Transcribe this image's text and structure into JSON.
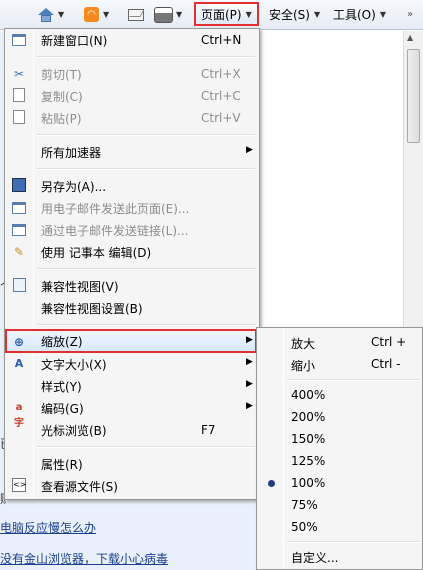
{
  "toolbar": {
    "page": "页面(P)",
    "safety": "安全(S)",
    "tools": "工具(O)",
    "more": "»"
  },
  "background": {
    "links": [
      "电脑反应慢怎么办",
      "没有金山浏览器，下载小心病毒"
    ],
    "fragments": [
      "个",
      "已",
      "贼"
    ]
  },
  "menu": {
    "new_window": {
      "label": "新建窗口(N)",
      "shortcut": "Ctrl+N"
    },
    "cut": {
      "label": "剪切(T)",
      "shortcut": "Ctrl+X"
    },
    "copy": {
      "label": "复制(C)",
      "shortcut": "Ctrl+C"
    },
    "paste": {
      "label": "粘贴(P)",
      "shortcut": "Ctrl+V"
    },
    "accelerators": {
      "label": "所有加速器"
    },
    "save_as": {
      "label": "另存为(A)..."
    },
    "email_page": {
      "label": "用电子邮件发送此页面(E)..."
    },
    "email_link": {
      "label": "通过电子邮件发送链接(L)..."
    },
    "edit_with": {
      "label": "使用 记事本 编辑(D)"
    },
    "compat_view": {
      "label": "兼容性视图(V)"
    },
    "compat_settings": {
      "label": "兼容性视图设置(B)"
    },
    "zoom": {
      "label": "缩放(Z)"
    },
    "text_size": {
      "label": "文字大小(X)"
    },
    "style": {
      "label": "样式(Y)"
    },
    "encoding": {
      "label": "编码(G)"
    },
    "caret_browsing": {
      "label": "光标浏览(B)",
      "shortcut": "F7"
    },
    "properties": {
      "label": "属性(R)"
    },
    "view_source": {
      "label": "查看源文件(S)"
    }
  },
  "zoom_submenu": {
    "zoom_in": {
      "label": "放大",
      "shortcut": "Ctrl +"
    },
    "zoom_out": {
      "label": "缩小",
      "shortcut": "Ctrl -"
    },
    "levels": [
      "400%",
      "200%",
      "150%",
      "125%",
      "100%",
      "75%",
      "50%"
    ],
    "selected": "100%",
    "custom": {
      "label": "自定义..."
    }
  }
}
